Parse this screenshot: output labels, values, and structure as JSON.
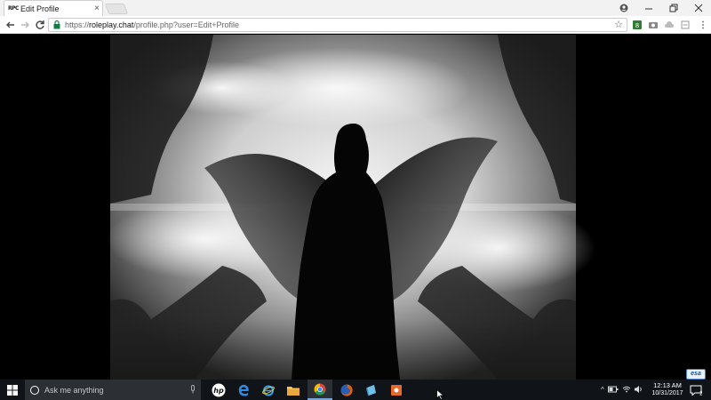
{
  "browser": {
    "tab_title": "Edit Profile",
    "tab_favicon": "RPC",
    "url_scheme": "https://",
    "url_host": "roleplay.chat",
    "url_path": "/profile.php?user=Edit+Profile"
  },
  "taskbar": {
    "search_placeholder": "Ask me anything",
    "pinned_icons": [
      "hp-icon",
      "edge-icon",
      "internet-explorer-icon",
      "file-explorer-icon",
      "chrome-icon",
      "firefox-icon",
      "app-icon",
      "orange-app-icon"
    ],
    "time": "12:13 AM",
    "date": "10/31/2017",
    "notification_count": "2",
    "tray_badge": "esa"
  },
  "colors": {
    "taskbar_bg": "#101418",
    "chrome_toolbar": "#ffffff",
    "accent": "#7aa6d6"
  }
}
